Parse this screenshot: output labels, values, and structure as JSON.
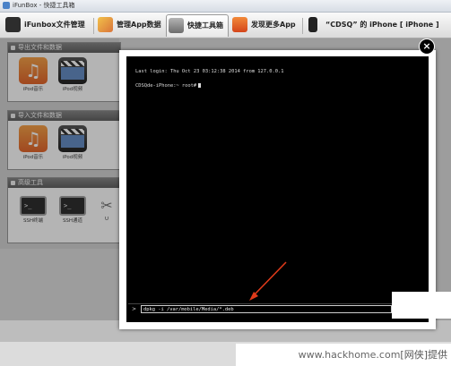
{
  "window": {
    "title": "iFunBox - 快捷工具箱"
  },
  "tabs": [
    {
      "label": "iFunbox文件管理",
      "icon": "phone-icon",
      "color": "#2d2d2d"
    },
    {
      "label": "管理App数据",
      "icon": "apps-grid-icon",
      "color": "#e0a040"
    },
    {
      "label": "快捷工具箱",
      "icon": "toolbox-icon",
      "color": "#7a7a7a",
      "active": true
    },
    {
      "label": "发现更多App",
      "icon": "appstore-icon",
      "color": "#e36a2a"
    },
    {
      "label": "“CDSQ” 的 iPhone [ iPhone ]",
      "icon": "iphone-icon",
      "color": "#222222"
    }
  ],
  "sections": {
    "export": {
      "title": "导出文件和数据",
      "tools": [
        {
          "label": "iPod音乐"
        },
        {
          "label": "iPod视频"
        }
      ]
    },
    "import": {
      "title": "导入文件和数据",
      "tools": [
        {
          "label": "iPod音乐"
        },
        {
          "label": "iPod视频"
        }
      ]
    },
    "advanced": {
      "title": "高级工具",
      "tools": [
        {
          "label": "SSH终端"
        },
        {
          "label": "SSH通道"
        },
        {
          "label": "U"
        }
      ]
    }
  },
  "terminal": {
    "lines": [
      "Last login: Thu Oct 23 03:12:38 2014 from 127.0.0.1",
      "CDSQde-iPhone:~ root#"
    ],
    "prompt_chevron": ">",
    "command": "dpkg -i /var/mobile/Media/*.deb"
  },
  "modal": {
    "close_label": "×"
  },
  "watermark": {
    "host": "www.hackhome.com",
    "brand": "[网侠]提供"
  },
  "colors": {
    "terminal_bg": "#000000",
    "arrow": "#e03a1a"
  }
}
